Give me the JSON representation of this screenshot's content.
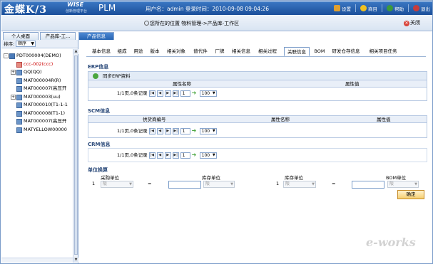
{
  "header": {
    "logo_text": "金蝶K/3",
    "logo_wise": "WISE",
    "logo_slogan": "创新管理平台",
    "product": "PLM",
    "user_info": "用户名：admin  登录时间：2010-09-08 09:04:26",
    "buttons": [
      {
        "label": "设置",
        "icon": "tools-icon",
        "color": "#e0a030"
      },
      {
        "label": "商目",
        "icon": "info-icon",
        "color": "#f0c020"
      },
      {
        "label": "帮助",
        "icon": "help-icon",
        "color": "#3c9a3a"
      },
      {
        "label": "退出",
        "icon": "exit-icon",
        "color": "#c83c3c"
      }
    ]
  },
  "bar2": {
    "breadcrumb_prefix": "您所在的位置",
    "breadcrumb_path": "物料管理->产品库-工作区",
    "close_label": "关闭"
  },
  "tabs": [
    {
      "label": "个人桌面",
      "active": false
    },
    {
      "label": "产品库-工...",
      "active": false
    },
    {
      "label": "产品信息",
      "active": true
    }
  ],
  "left": {
    "sort_label": "排序:",
    "sort_value": "顺序",
    "tree": [
      {
        "label": "PDT000004(DEMO)",
        "level": 0,
        "expander": "-",
        "red": false
      },
      {
        "label": "ccc-002(ccc)",
        "level": 1,
        "expander": "",
        "red": true
      },
      {
        "label": "QQ(QQ)",
        "level": 1,
        "expander": "+",
        "red": false
      },
      {
        "label": "MAT000004R(R)",
        "level": 1,
        "expander": "",
        "red": false
      },
      {
        "label": "MAT000007(高压开",
        "level": 1,
        "expander": "",
        "red": false
      },
      {
        "label": "MAT000003(uu)",
        "level": 1,
        "expander": "+",
        "red": false
      },
      {
        "label": "MAT000010(T1-1-1",
        "level": 1,
        "expander": "",
        "red": false
      },
      {
        "label": "MAT000008(T1-1)",
        "level": 1,
        "expander": "",
        "red": false
      },
      {
        "label": "MAT000007(高压开",
        "level": 1,
        "expander": "",
        "red": false
      },
      {
        "label": "MATYELLOW00000",
        "level": 1,
        "expander": "",
        "red": false
      }
    ]
  },
  "subtabs": [
    {
      "label": "基本信息",
      "active": false
    },
    {
      "label": "组成",
      "active": false
    },
    {
      "label": "用途",
      "active": false
    },
    {
      "label": "版本",
      "active": false
    },
    {
      "label": "相关对象",
      "active": false
    },
    {
      "label": "替代件",
      "active": false
    },
    {
      "label": "厂牌",
      "active": false
    },
    {
      "label": "相关信息",
      "active": false
    },
    {
      "label": "相关过程",
      "active": false
    },
    {
      "label": "关联信息",
      "active": true
    },
    {
      "label": "BOM",
      "active": false
    },
    {
      "label": "研发仓存信息",
      "active": false
    },
    {
      "label": "相关项目任务",
      "active": false
    }
  ],
  "erp": {
    "title": "ERP信息",
    "sync_label": "同步ERP资料",
    "col_name": "属性名称",
    "col_value": "属性值",
    "pager_text": "1/1页,0条记录",
    "page_input": "1",
    "page_size": "100"
  },
  "scm": {
    "title": "SCM信息",
    "col_supplier": "供货商编号",
    "col_name": "属性名称",
    "col_value": "属性值",
    "pager_text": "1/1页,0条记录",
    "page_input": "1",
    "page_size": "100"
  },
  "crm": {
    "title": "CRM信息",
    "pager_text": "1/1页,0条记录",
    "page_input": "1",
    "page_size": "100"
  },
  "units": {
    "title": "单位换算",
    "purchase_unit": "采购单位",
    "stock_unit_1": "库存单位",
    "stock_unit_2": "库存单位",
    "bom_unit": "BOM单位",
    "qty_left": "1",
    "qty_right": "1",
    "eq": "=",
    "select_placeholder": "阪",
    "confirm_label": "确定"
  },
  "watermark": "e-works"
}
